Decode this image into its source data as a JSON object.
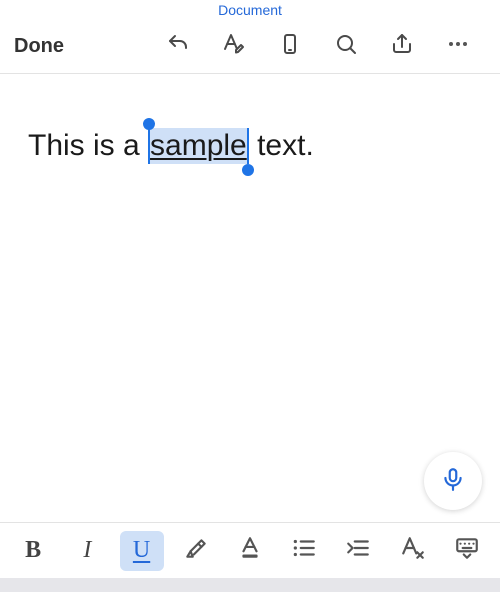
{
  "title": "Document",
  "toolbar": {
    "done_label": "Done"
  },
  "content": {
    "prefix": "This is a ",
    "selected": "sample",
    "suffix": " text."
  },
  "format": {
    "bold": "B",
    "italic": "I",
    "underline": "U",
    "underline_active": true
  }
}
